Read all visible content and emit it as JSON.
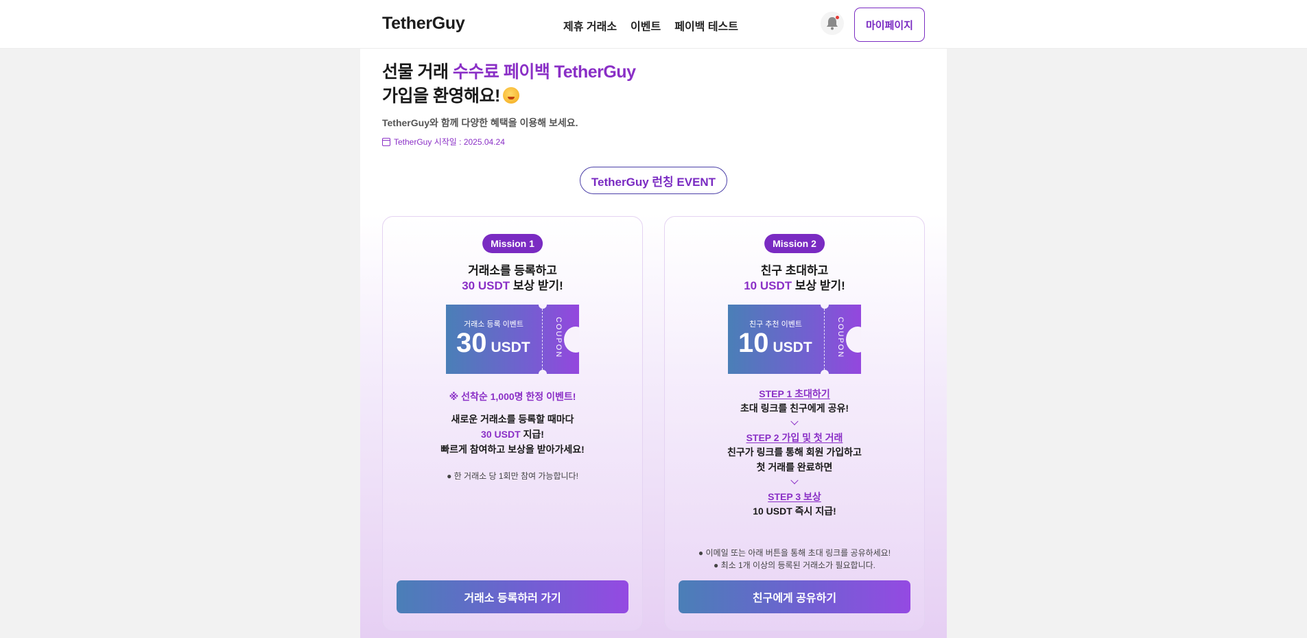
{
  "header": {
    "logo": "TetherGuy",
    "nav": [
      "제휴 거래소",
      "이벤트",
      "페이백 테스트"
    ],
    "mypage_label": "마이페이지"
  },
  "hero": {
    "title_prefix": "선물 거래 ",
    "title_accent": "수수료 페이백 TetherGuy",
    "title_line2": "가입을 환영해요!",
    "subtitle": "TetherGuy와 함께 다양한 혜택을 이용해 보세요.",
    "start_date": "TetherGuy 시작일 : 2025.04.24"
  },
  "event_label": "TetherGuy 런칭 EVENT",
  "missions": [
    {
      "badge": "Mission 1",
      "title_line1": "거래소를 등록하고",
      "title_accent": "30 USDT",
      "title_rest": " 보상 받기!",
      "coupon": {
        "label": "거래소 등록 이벤트",
        "amount": "30",
        "unit": "USDT",
        "side": "COUPON"
      },
      "limited": "※ 선착순 1,000명 한정 이벤트!",
      "desc_line1": "새로운 거래소를 등록할 때마다",
      "desc_accent": "30 USDT",
      "desc_rest": " 지급!",
      "desc_line3": "빠르게 참여하고 보상을 받아가세요!",
      "note": "● 한 거래소 당 1회만 참여 가능합니다!",
      "cta": "거래소 등록하러 가기"
    },
    {
      "badge": "Mission 2",
      "title_line1": "친구 초대하고",
      "title_accent": "10 USDT",
      "title_rest": " 보상 받기!",
      "coupon": {
        "label": "친구 추천 이벤트",
        "amount": "10",
        "unit": "USDT",
        "side": "COUPON"
      },
      "steps": [
        {
          "title": "STEP 1 초대하기",
          "desc": [
            "초대 링크를 친구에게 공유!"
          ]
        },
        {
          "title": "STEP 2 가입 및 첫 거래",
          "desc": [
            "친구가 링크를 통해 회원 가입하고",
            "첫 거래를 완료하면"
          ]
        },
        {
          "title": "STEP 3 보상",
          "desc": [
            "10 USDT 즉시 지급!"
          ]
        }
      ],
      "notes": [
        "● 이메일 또는 아래 버튼을 통해 초대 링크를 공유하세요!",
        "● 최소 1개 이상의 등록된 거래소가 필요합니다."
      ],
      "cta": "친구에게 공유하기"
    }
  ],
  "colors": {
    "accent": "#8a2fc6",
    "badge": "#7a2bc2",
    "gradient_start": "#4a7fb7",
    "gradient_end": "#944ae2"
  },
  "icons": {
    "notification": "bell-icon",
    "date": "calendar-icon"
  }
}
